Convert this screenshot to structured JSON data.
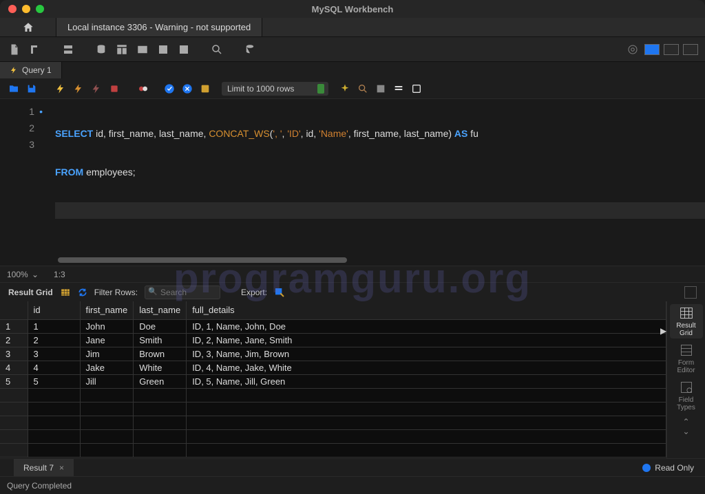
{
  "window": {
    "title": "MySQL Workbench"
  },
  "connection_tab": "Local instance 3306 - Warning - not supported",
  "query_tab": "Query 1",
  "limit_dropdown": "Limit to 1000 rows",
  "sql": {
    "line1_pre": "SELECT",
    "line1_mid": " id, first_name, last_name, ",
    "line1_fn": "CONCAT_WS",
    "line1_paren": "(",
    "line1_s1": "', '",
    "line1_c1": ", ",
    "line1_s2": "'ID'",
    "line1_c2": ", id, ",
    "line1_s3": "'Name'",
    "line1_c3": ", first_name, last_name) ",
    "line1_as": "AS",
    "line1_tail": " fu",
    "line2_kw": "FROM",
    "line2_rest": " employees;"
  },
  "zoom": "100%",
  "cursor_pos": "1:3",
  "results_label": "Result Grid",
  "filter_label": "Filter Rows:",
  "filter_placeholder": "Search",
  "export_label": "Export:",
  "columns": [
    "id",
    "first_name",
    "last_name",
    "full_details"
  ],
  "rows": [
    {
      "n": "1",
      "id": "1",
      "first_name": "John",
      "last_name": "Doe",
      "full_details": "ID, 1, Name, John, Doe"
    },
    {
      "n": "2",
      "id": "2",
      "first_name": "Jane",
      "last_name": "Smith",
      "full_details": "ID, 2, Name, Jane, Smith"
    },
    {
      "n": "3",
      "id": "3",
      "first_name": "Jim",
      "last_name": "Brown",
      "full_details": "ID, 3, Name, Jim, Brown"
    },
    {
      "n": "4",
      "id": "4",
      "first_name": "Jake",
      "last_name": "White",
      "full_details": "ID, 4, Name, Jake, White"
    },
    {
      "n": "5",
      "id": "5",
      "first_name": "Jill",
      "last_name": "Green",
      "full_details": "ID, 5, Name, Jill, Green"
    }
  ],
  "side": {
    "grid": "Result Grid",
    "form": "Form Editor",
    "field": "Field Types"
  },
  "result_tab": "Result 7",
  "readonly": "Read Only",
  "status": "Query Completed",
  "watermark": "programguru.org"
}
